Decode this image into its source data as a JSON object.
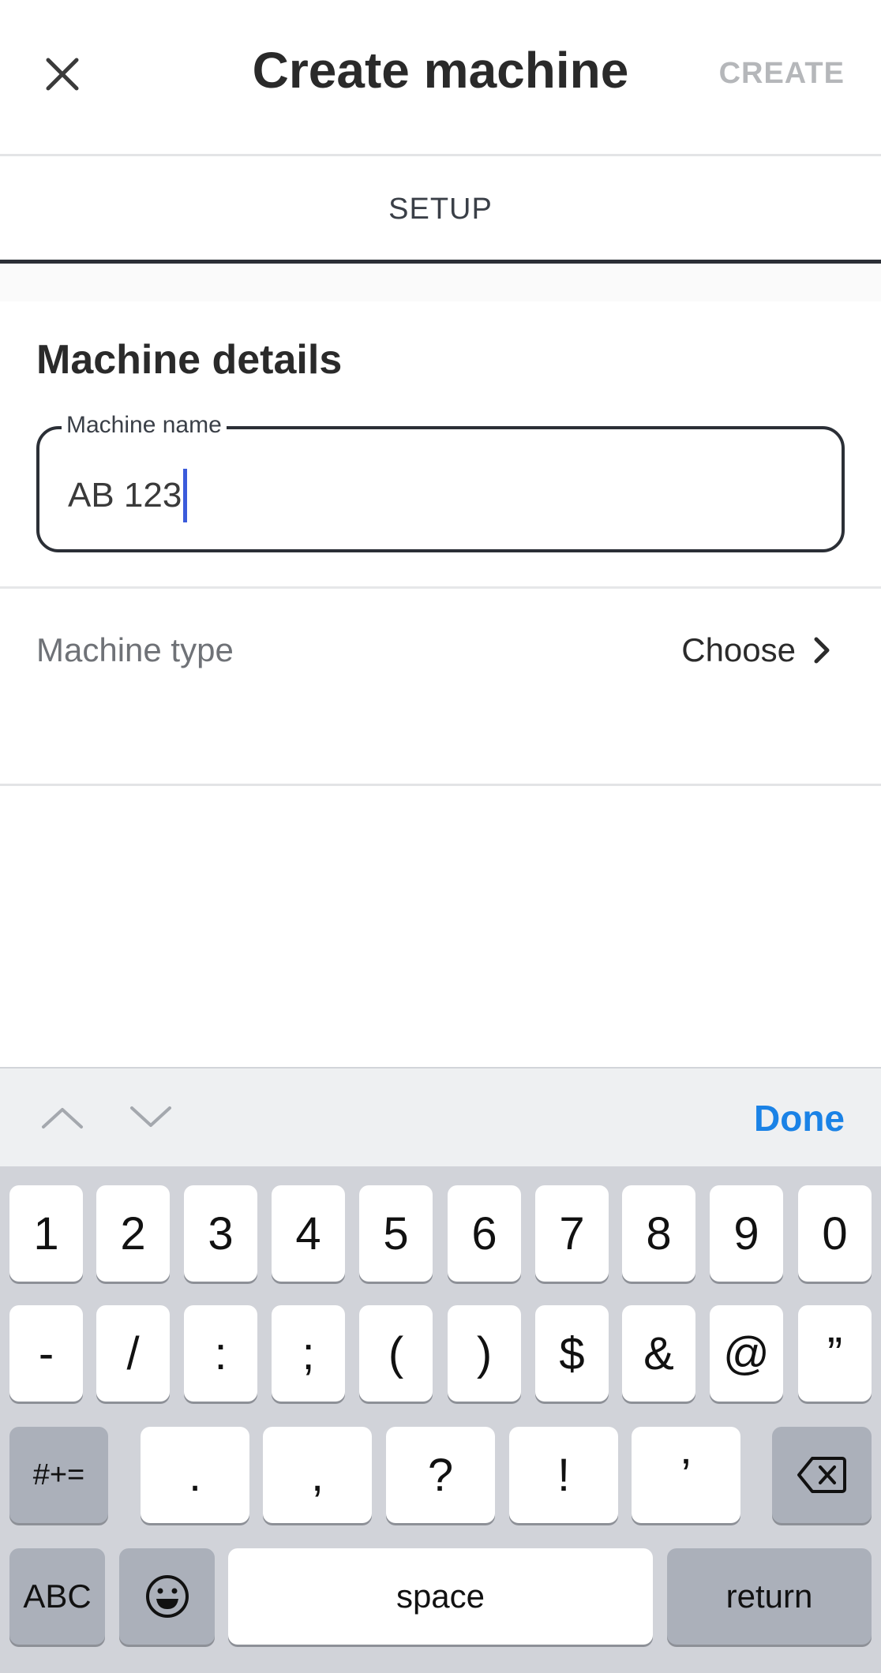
{
  "header": {
    "close_icon": "close-icon",
    "title": "Create machine",
    "create_label": "CREATE"
  },
  "tabs": [
    {
      "label": "SETUP",
      "selected": true
    }
  ],
  "details": {
    "title": "Machine details",
    "name_field": {
      "label": "Machine name",
      "value": "AB 123"
    }
  },
  "machine_type": {
    "label": "Machine type",
    "value": "Choose",
    "icon": "chevron-right-icon"
  },
  "accessory": {
    "prev_icon": "chevron-up-icon",
    "next_icon": "chevron-down-icon",
    "done_label": "Done"
  },
  "keyboard": {
    "row1": [
      "1",
      "2",
      "3",
      "4",
      "5",
      "6",
      "7",
      "8",
      "9",
      "0"
    ],
    "row2": [
      "-",
      "/",
      ":",
      ";",
      "(",
      ")",
      "$",
      "&",
      "@",
      "”"
    ],
    "row3": {
      "shift_label": "#+=",
      "keys": [
        ".",
        ",",
        "?",
        "!",
        "’"
      ],
      "delete_icon": "backspace-icon"
    },
    "row4": {
      "abc_label": "ABC",
      "emoji_icon": "emoji-icon",
      "space_label": "space",
      "return_label": "return"
    }
  },
  "colors": {
    "accent_blue": "#1a82e6",
    "caret": "#3b5bdb",
    "disabled": "#b5b7ba",
    "border_dark": "#2b2f36"
  }
}
